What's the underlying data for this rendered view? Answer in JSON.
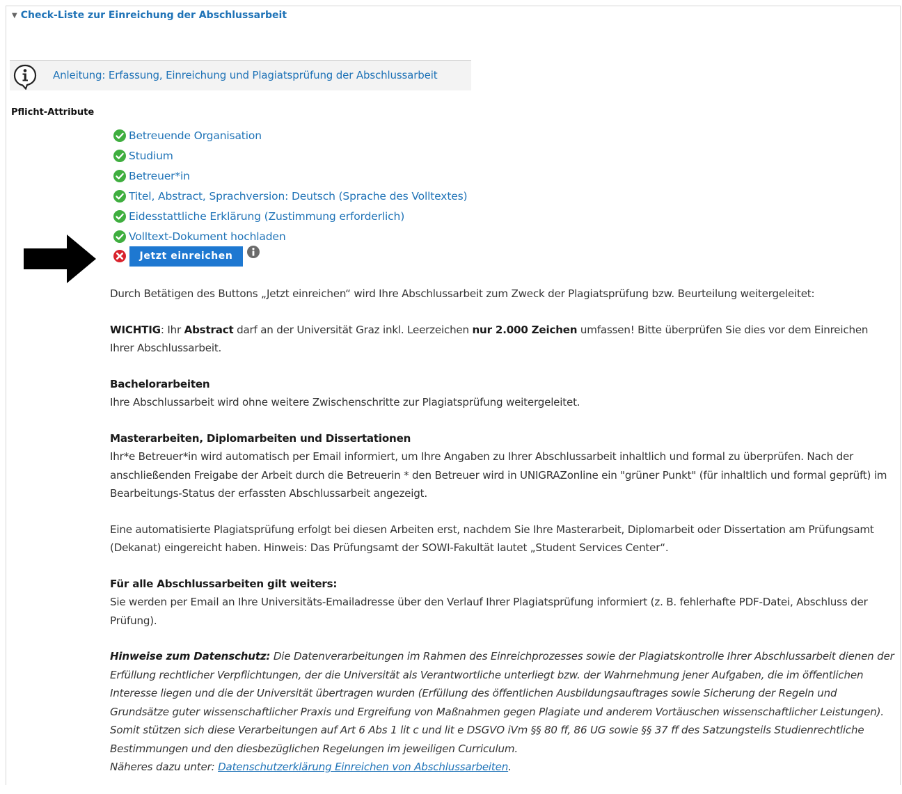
{
  "section": {
    "title": "Check-Liste zur Einreichung der Abschlussarbeit"
  },
  "info": {
    "link": "Anleitung: Erfassung, Einreichung und Plagiatsprüfung der Abschlussarbeit"
  },
  "pflicht_label": "Pflicht-Attribute",
  "checklist": [
    {
      "label": "Betreuende Organisation",
      "status": "done"
    },
    {
      "label": "Studium",
      "status": "done"
    },
    {
      "label": "Betreuer*in",
      "status": "done"
    },
    {
      "label": "Titel, Abstract, Sprachversion: Deutsch (Sprache des Volltextes)",
      "status": "done"
    },
    {
      "label": "Eidesstattliche Erklärung (Zustimmung erforderlich)",
      "status": "done"
    },
    {
      "label": "Volltext-Dokument hochladen",
      "status": "done"
    }
  ],
  "submit": {
    "label": "Jetzt einreichen",
    "status": "error"
  },
  "content": {
    "intro": "Durch Betätigen des Buttons „Jetzt einreichen“ wird Ihre Abschlussarbeit zum Zweck der Plagiatsprüfung bzw. Beurteilung weitergeleitet:",
    "wichtig": {
      "label": "WICHTIG",
      "t1": ": Ihr ",
      "abstract": "Abstract",
      "t2": " darf an der Universität Graz inkl. Leerzeichen ",
      "limit": "nur 2.000 Zeichen",
      "t3": " umfassen! Bitte überprüfen Sie dies vor dem Einreichen Ihrer Abschlussarbeit."
    },
    "bachelor": {
      "heading": "Bachelorarbeiten",
      "text": "Ihre Abschlussarbeit wird ohne weitere Zwischenschritte zur Plagiatsprüfung weitergeleitet."
    },
    "master": {
      "heading": "Masterarbeiten, Diplomarbeiten und Dissertationen",
      "text": "Ihr*e Betreuer*in wird automatisch per Email informiert, um Ihre Angaben zu Ihrer Abschlussarbeit inhaltlich und formal zu überprüfen. Nach der anschließenden Freigabe der Arbeit durch die Betreuerin * den Betreuer wird in UNIGRAZonline ein \"grüner Punkt\" (für inhaltlich und formal geprüft) im Bearbeitungs-Status der erfassten Abschlussarbeit angezeigt."
    },
    "auto": "Eine automatisierte Plagiatsprüfung erfolgt bei diesen Arbeiten erst, nachdem Sie Ihre Masterarbeit, Diplomarbeit oder Dissertation am Prüfungsamt (Dekanat) eingereicht haben. Hinweis: Das Prüfungsamt der SOWI-Fakultät lautet „Student Services Center“.",
    "all": {
      "heading": "Für alle Abschlussarbeiten gilt weiters:",
      "text": "Sie werden per Email an Ihre Universitäts-Emailadresse über den Verlauf Ihrer Plagiatsprüfung informiert (z. B. fehlerhafte PDF-Datei, Abschluss der Prüfung)."
    },
    "privacy": {
      "label": "Hinweise zum Datenschutz:",
      "text": " Die Datenverarbeitungen im Rahmen des Einreichprozesses sowie der Plagiatskontrolle Ihrer Abschlussarbeit dienen der Erfüllung rechtlicher Verpflichtungen, der die Universität als Verantwortliche unterliegt bzw. der Wahrnehmung jener Aufgaben, die im öffentlichen Interesse liegen und die der Universität übertragen wurden (Erfüllung des öffentlichen Ausbildungsauftrages sowie Sicherung der Regeln und Grundsätze guter wissenschaftlicher Praxis und Ergreifung von Maßnahmen gegen Plagiate und anderem Vortäuschen wissenschaftlicher Leistungen). Somit stützen sich diese Verarbeitungen auf Art 6 Abs 1 lit c und lit e DSGVO iVm §§ 80 ff, 86 UG sowie §§ 37 ff des Satzungsteils Studienrechtliche Bestimmungen und den diesbezüglichen Regelungen im jeweiligen Curriculum.",
      "more": "Näheres dazu unter: ",
      "more_link": "Datenschutzerklärung Einreichen von Abschlussarbeiten",
      "more_end": "."
    }
  },
  "colors": {
    "link": "#1f73b7",
    "button": "#1e78d1",
    "ok": "#3fae3f",
    "error": "#d9232d"
  },
  "icons": [
    "triangle-down-icon",
    "info-speech-icon",
    "check-circle-icon",
    "error-x-icon",
    "info-circle-icon",
    "arrow-right-icon"
  ]
}
